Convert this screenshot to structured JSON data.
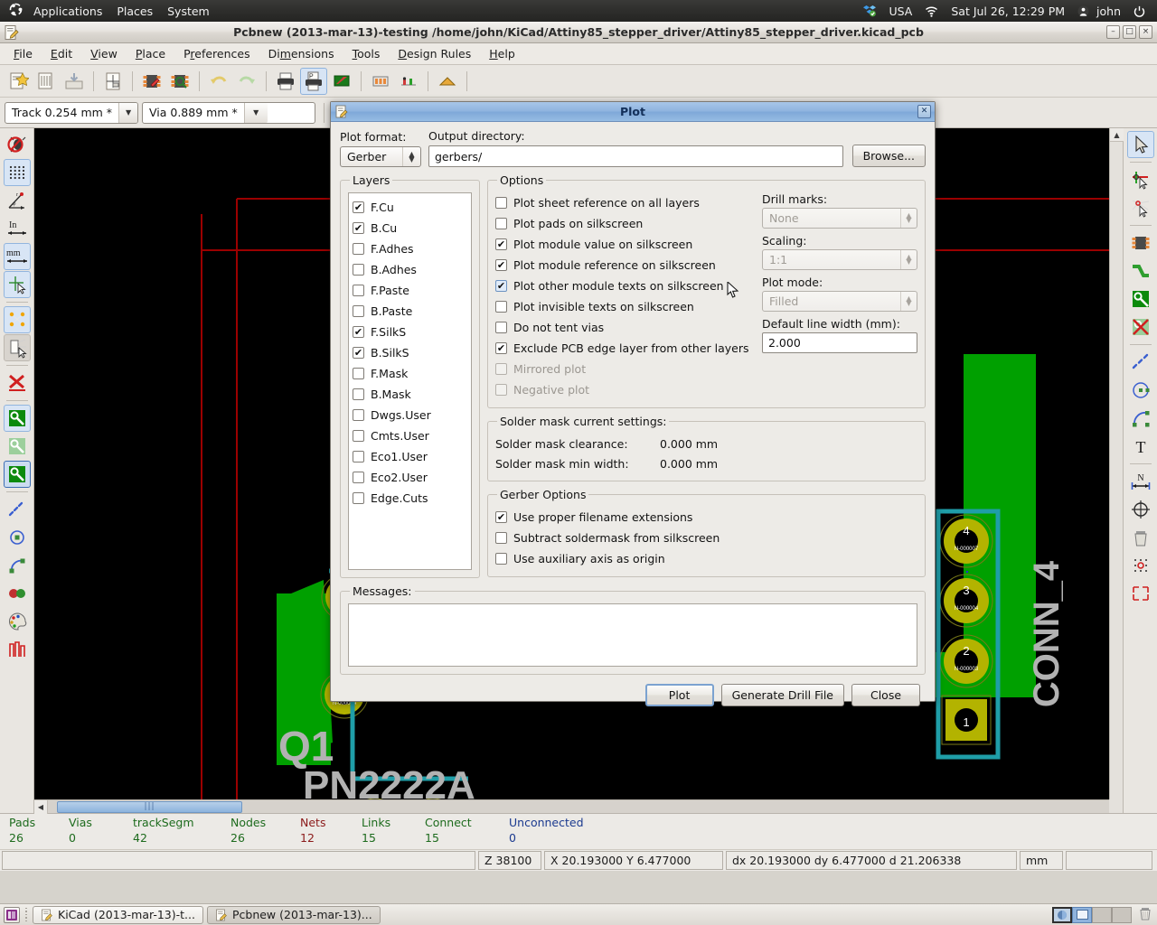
{
  "desktop": {
    "panel": {
      "logo_icon": "ubuntu-logo-icon",
      "menus": [
        "Applications",
        "Places",
        "System"
      ],
      "keyboard_layout": "USA",
      "network_icon": "wifi-icon",
      "dropbox_icon": "dropbox-icon",
      "clock": "Sat Jul 26, 12:29 PM",
      "user": "john",
      "power_icon": "power-icon"
    },
    "taskbar": {
      "show_desktop_icon": "show-desktop-icon",
      "tasks": [
        {
          "label": "KiCad (2013-mar-13)-t...",
          "icon": "kicad-icon",
          "active": false
        },
        {
          "label": "Pcbnew (2013-mar-13)...",
          "icon": "pcbnew-icon",
          "active": true
        }
      ],
      "workspaces": [
        "workspace-1",
        "workspace-2",
        "workspace-3",
        "workspace-4"
      ],
      "current_workspace": 2,
      "trash_icon": "trash-icon"
    }
  },
  "window": {
    "icon": "pcbnew-icon",
    "title": "Pcbnew (2013-mar-13)-testing /home/john/KiCad/Attiny85_stepper_driver/Attiny85_stepper_driver.kicad_pcb",
    "buttons": {
      "minimize": "–",
      "maximize": "□",
      "close": "×"
    }
  },
  "menubar": {
    "items": [
      "File",
      "Edit",
      "View",
      "Place",
      "Preferences",
      "Dimensions",
      "Tools",
      "Design Rules",
      "Help"
    ]
  },
  "toolbar": {
    "items": [
      {
        "name": "new-board-button",
        "icon": "new-board-icon"
      },
      {
        "name": "open-board-button",
        "icon": "open-board-icon"
      },
      {
        "name": "save-board-button",
        "icon": "save-board-icon"
      },
      {
        "name": "page-settings-button",
        "icon": "page-settings-icon"
      },
      {
        "name": "open-module-editor-button",
        "icon": "module-editor-icon"
      },
      {
        "name": "open-module-viewer-button",
        "icon": "module-viewer-icon"
      },
      {
        "name": "undo-button",
        "icon": "undo-icon"
      },
      {
        "name": "redo-button",
        "icon": "redo-icon"
      },
      {
        "name": "print-button",
        "icon": "print-icon"
      },
      {
        "name": "plot-button",
        "icon": "plot-icon"
      },
      {
        "name": "open-3d-viewer-button",
        "icon": "3d-viewer-icon"
      },
      {
        "name": "zoom-in-button",
        "icon": "zoom-in-icon"
      },
      {
        "name": "zoom-out-button",
        "icon": "zoom-out-icon"
      },
      {
        "name": "zoom-fit-button",
        "icon": "zoom-fit-icon"
      },
      {
        "name": "zoom-redraw-button",
        "icon": "zoom-redraw-icon"
      },
      {
        "name": "find-button",
        "icon": "find-icon"
      },
      {
        "name": "netlist-button",
        "icon": "netlist-icon"
      },
      {
        "name": "drc-button",
        "icon": "drc-icon"
      },
      {
        "name": "layer-pair-button",
        "icon": "layer-pair-icon"
      },
      {
        "name": "mode-module-button",
        "icon": "mode-module-icon"
      },
      {
        "name": "mode-track-button",
        "icon": "mode-track-icon"
      },
      {
        "name": "hide-ratsnest-button",
        "icon": "ratsnest-icon"
      }
    ]
  },
  "toolbar2": {
    "track_width": "Track 0.254 mm *",
    "via_size": "Via 0.889 mm *"
  },
  "left_toolbar": {
    "items": [
      {
        "name": "drc-off-button",
        "icon": "drc-disabled-icon",
        "state": "normal"
      },
      {
        "name": "grid-visibility-button",
        "icon": "grid-icon",
        "state": "selected"
      },
      {
        "name": "polar-coords-button",
        "icon": "polar-coords-icon",
        "state": "normal"
      },
      {
        "name": "units-inches-button",
        "icon": "inches-icon",
        "state": "normal"
      },
      {
        "name": "units-mm-button",
        "icon": "mm-icon",
        "state": "selected"
      },
      {
        "name": "cursor-shape-button",
        "icon": "cursor-shape-icon",
        "state": "selected"
      },
      {
        "name": "show-ratsnest-button",
        "icon": "ratsnest-pads-icon",
        "state": "selected"
      },
      {
        "name": "module-ratsnest-button",
        "icon": "module-ratsnest-icon",
        "state": "pressed"
      },
      {
        "name": "auto-delete-track-button",
        "icon": "auto-delete-track-icon",
        "state": "normal"
      },
      {
        "name": "show-zones-button",
        "icon": "zone-filled-icon",
        "state": "selected"
      },
      {
        "name": "show-zones-outline-button",
        "icon": "zone-outline-icon",
        "state": "normal"
      },
      {
        "name": "hide-zones-button",
        "icon": "zone-hidden-icon",
        "state": "selstrong"
      },
      {
        "name": "pads-sketch-button",
        "icon": "pad-sketch-icon",
        "state": "normal"
      },
      {
        "name": "vias-sketch-button",
        "icon": "via-sketch-icon",
        "state": "normal"
      },
      {
        "name": "tracks-sketch-button",
        "icon": "track-sketch-icon",
        "state": "normal"
      },
      {
        "name": "high-contrast-button",
        "icon": "contrast-icon",
        "state": "normal"
      },
      {
        "name": "microwave-tools-button",
        "icon": "microwave-icon",
        "state": "normal"
      }
    ]
  },
  "right_toolbar": {
    "items": [
      {
        "name": "select-tool-button",
        "icon": "cursor-arrow-icon",
        "state": "selected"
      },
      {
        "name": "highlight-net-button",
        "icon": "highlight-net-icon",
        "state": "normal"
      },
      {
        "name": "local-ratsnest-button",
        "icon": "local-ratsnest-icon",
        "state": "normal"
      },
      {
        "name": "add-module-button",
        "icon": "module-icon",
        "state": "normal"
      },
      {
        "name": "add-track-button",
        "icon": "track-icon",
        "state": "normal"
      },
      {
        "name": "add-zone-button",
        "icon": "zone-icon",
        "state": "normal"
      },
      {
        "name": "add-keepout-button",
        "icon": "keepout-icon",
        "state": "normal"
      },
      {
        "name": "add-line-button",
        "icon": "line-icon",
        "state": "normal"
      },
      {
        "name": "add-circle-button",
        "icon": "circle-icon",
        "state": "normal"
      },
      {
        "name": "add-arc-button",
        "icon": "arc-icon",
        "state": "normal"
      },
      {
        "name": "add-text-button",
        "icon": "text-icon",
        "state": "normal"
      },
      {
        "name": "add-dimension-button",
        "icon": "dimension-icon",
        "state": "normal"
      },
      {
        "name": "add-mire-button",
        "icon": "mire-icon",
        "state": "normal"
      },
      {
        "name": "delete-button",
        "icon": "delete-icon",
        "state": "normal"
      },
      {
        "name": "set-origin-button",
        "icon": "origin-icon",
        "state": "normal"
      },
      {
        "name": "grid-origin-button",
        "icon": "grid-origin-icon",
        "state": "normal"
      }
    ]
  },
  "canvas": {
    "silkscreen_labels": [
      "CONN_4",
      "PN2222A",
      "Q1"
    ],
    "pad_numbers": [
      "1",
      "2",
      "3",
      "4"
    ],
    "pad_net_label": "N-000007",
    "background_color": "#000000",
    "copper_color": "#00a000",
    "pad_color": "#b3b300",
    "silk_color": "#b2b2b2",
    "edge_color": "#a00000",
    "module_outline_color": "#1f9ea8"
  },
  "statusbar": {
    "counters": [
      {
        "label": "Pads",
        "value": "26",
        "color": "#1d6b1d"
      },
      {
        "label": "Vias",
        "value": "0",
        "color": "#1d6b1d"
      },
      {
        "label": "trackSegm",
        "value": "42",
        "color": "#1d6b1d"
      },
      {
        "label": "Nodes",
        "value": "26",
        "color": "#1d6b1d"
      },
      {
        "label": "Nets",
        "value": "12",
        "color": "#8b1a1a"
      },
      {
        "label": "Links",
        "value": "15",
        "color": "#1d6b1d"
      },
      {
        "label": "Connect",
        "value": "15",
        "color": "#1d6b1d"
      },
      {
        "label": "Unconnected",
        "value": "0",
        "color": "#1b3a8f"
      }
    ],
    "message": "",
    "zoom": "Z 38100",
    "position": "X 20.193000  Y 6.477000",
    "delta": "dx 20.193000  dy 6.477000  d 21.206338",
    "units": "mm"
  },
  "dialog": {
    "title": "Plot",
    "icon": "plot-icon",
    "close_icon": "close-icon",
    "plot_format_label": "Plot format:",
    "plot_format_value": "Gerber",
    "output_directory_label": "Output directory:",
    "output_directory_value": "gerbers/",
    "output_directory_placeholder": "",
    "browse_label": "Browse...",
    "layers": {
      "legend": "Layers",
      "items": [
        {
          "label": "F.Cu",
          "checked": true
        },
        {
          "label": "B.Cu",
          "checked": true
        },
        {
          "label": "F.Adhes",
          "checked": false
        },
        {
          "label": "B.Adhes",
          "checked": false
        },
        {
          "label": "F.Paste",
          "checked": false
        },
        {
          "label": "B.Paste",
          "checked": false
        },
        {
          "label": "F.SilkS",
          "checked": true
        },
        {
          "label": "B.SilkS",
          "checked": true
        },
        {
          "label": "F.Mask",
          "checked": false
        },
        {
          "label": "B.Mask",
          "checked": false
        },
        {
          "label": "Dwgs.User",
          "checked": false
        },
        {
          "label": "Cmts.User",
          "checked": false
        },
        {
          "label": "Eco1.User",
          "checked": false
        },
        {
          "label": "Eco2.User",
          "checked": false
        },
        {
          "label": "Edge.Cuts",
          "checked": false
        }
      ]
    },
    "options": {
      "legend": "Options",
      "items": [
        {
          "label": "Plot sheet reference on all layers",
          "checked": false,
          "enabled": true,
          "focused": false
        },
        {
          "label": "Plot pads on silkscreen",
          "checked": false,
          "enabled": true,
          "focused": false
        },
        {
          "label": "Plot module value on silkscreen",
          "checked": true,
          "enabled": true,
          "focused": false
        },
        {
          "label": "Plot module reference on silkscreen",
          "checked": true,
          "enabled": true,
          "focused": false
        },
        {
          "label": "Plot other module texts on silkscreen",
          "checked": true,
          "enabled": true,
          "focused": true
        },
        {
          "label": "Plot invisible texts on silkscreen",
          "checked": false,
          "enabled": true,
          "focused": false
        },
        {
          "label": "Do not tent vias",
          "checked": false,
          "enabled": true,
          "focused": false
        },
        {
          "label": "Exclude PCB edge layer from other layers",
          "checked": true,
          "enabled": true,
          "focused": false
        },
        {
          "label": "Mirrored plot",
          "checked": false,
          "enabled": false,
          "focused": false
        },
        {
          "label": "Negative plot",
          "checked": false,
          "enabled": false,
          "focused": false
        }
      ],
      "drill_marks_label": "Drill marks:",
      "drill_marks_value": "None",
      "scaling_label": "Scaling:",
      "scaling_value": "1:1",
      "plot_mode_label": "Plot mode:",
      "plot_mode_value": "Filled",
      "line_width_label": "Default line width (mm):",
      "line_width_value": "2.000"
    },
    "solder_mask": {
      "legend": "Solder mask current settings:",
      "rows": [
        {
          "label": "Solder mask clearance:",
          "value": "0.000 mm"
        },
        {
          "label": "Solder mask min width:",
          "value": "0.000 mm"
        }
      ]
    },
    "gerber_options": {
      "legend": "Gerber Options",
      "items": [
        {
          "label": "Use proper filename extensions",
          "checked": true
        },
        {
          "label": "Subtract soldermask from silkscreen",
          "checked": false
        },
        {
          "label": "Use auxiliary axis as origin",
          "checked": false
        }
      ]
    },
    "messages": {
      "legend": "Messages:",
      "text": ""
    },
    "buttons": {
      "plot": "Plot",
      "generate_drill_file": "Generate Drill File",
      "close": "Close"
    }
  }
}
